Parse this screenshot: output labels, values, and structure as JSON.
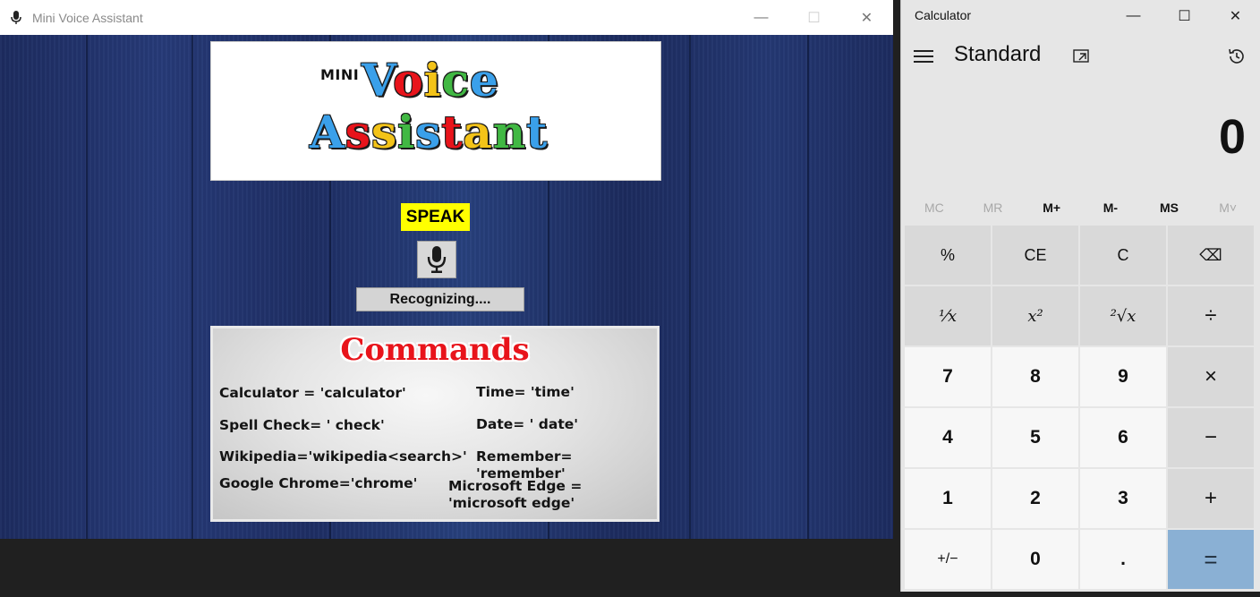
{
  "voice_window": {
    "title": "Mini Voice Assistant",
    "controls": {
      "minimize": "—",
      "maximize": "☐",
      "close": "✕"
    },
    "logo": {
      "mini": "MINI",
      "line1": "Voice",
      "line2": "Assistant"
    },
    "speak_label": "SPEAK",
    "status": "Recognizing....",
    "commands": {
      "title": "Commands",
      "items": [
        "Calculator = 'calculator'",
        "Time= 'time'",
        "Spell Check= ' check'",
        "Date= ' date'",
        "Wikipedia='wikipedia<search>'",
        "Remember= 'remember'",
        "Google Chrome='chrome'",
        "Microsoft Edge = 'microsoft edge'"
      ]
    }
  },
  "calculator": {
    "title": "Calculator",
    "controls": {
      "minimize": "—",
      "maximize": "☐",
      "close": "✕"
    },
    "mode": "Standard",
    "display": "0",
    "memory": [
      "MC",
      "MR",
      "M+",
      "M-",
      "MS",
      "M˅"
    ],
    "keys": [
      [
        "%",
        "CE",
        "C",
        "⌫"
      ],
      [
        "⅟x",
        "x²",
        "²√x",
        "÷"
      ],
      [
        "7",
        "8",
        "9",
        "×"
      ],
      [
        "4",
        "5",
        "6",
        "−"
      ],
      [
        "1",
        "2",
        "3",
        "+"
      ],
      [
        "+/−",
        "0",
        ".",
        "="
      ]
    ],
    "colors": {
      "equals": "#8ab0d4",
      "operator_key": "#d9d9d9",
      "number_key": "#f7f7f7"
    }
  }
}
